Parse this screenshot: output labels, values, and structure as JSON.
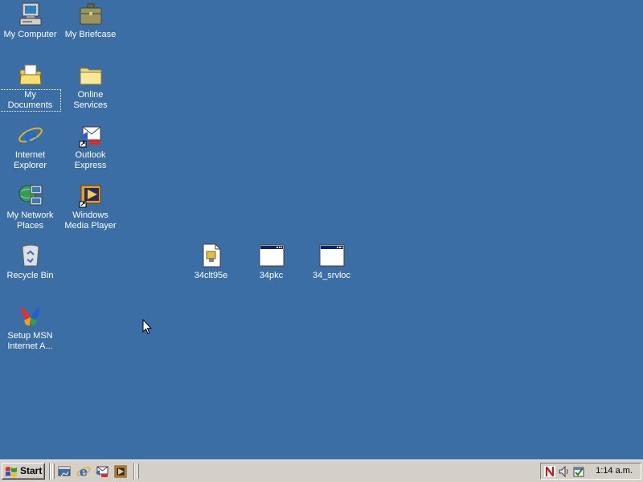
{
  "desktop": {
    "background_color": "#3a6ea5",
    "icons": [
      {
        "label": "My Computer",
        "icon": "my-computer-icon"
      },
      {
        "label": "My Briefcase",
        "icon": "briefcase-icon"
      },
      {
        "label": "My Documents",
        "icon": "my-documents-icon"
      },
      {
        "label": "Online\nServices",
        "icon": "folder-icon"
      },
      {
        "label": "Internet\nExplorer",
        "icon": "internet-explorer-icon"
      },
      {
        "label": "Outlook\nExpress",
        "icon": "outlook-express-icon"
      },
      {
        "label": "My Network\nPlaces",
        "icon": "network-places-icon"
      },
      {
        "label": "Windows\nMedia Player",
        "icon": "media-player-icon"
      },
      {
        "label": "Recycle Bin",
        "icon": "recycle-bin-icon"
      },
      {
        "label": "Setup MSN\nInternet A...",
        "icon": "msn-butterfly-icon"
      },
      {
        "label": "34clt95e",
        "icon": "setup-file-icon"
      },
      {
        "label": "34pkc",
        "icon": "window-app-icon"
      },
      {
        "label": "34_srvloc",
        "icon": "window-app-icon"
      }
    ]
  },
  "taskbar": {
    "start_label": "Start",
    "quick_launch": [
      "show-desktop-icon",
      "internet-explorer-icon",
      "outlook-express-icon",
      "media-player-icon"
    ],
    "tray_icons": [
      "norton-icon",
      "volume-icon",
      "scheduler-icon"
    ],
    "clock": "1:14 a.m."
  }
}
